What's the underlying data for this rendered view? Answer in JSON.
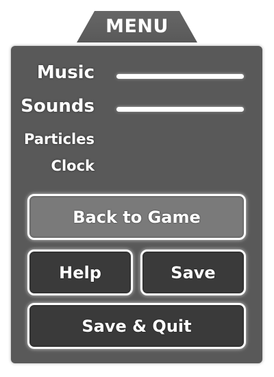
{
  "header": {
    "title": "MENU"
  },
  "settings": {
    "music": {
      "label": "Music",
      "level": 1.0
    },
    "sounds": {
      "label": "Sounds",
      "level": 1.0
    },
    "particles": {
      "label": "Particles"
    },
    "clock": {
      "label": "Clock"
    }
  },
  "buttons": {
    "back": "Back to Game",
    "help": "Help",
    "save": "Save",
    "save_quit": "Save & Quit"
  },
  "colors": {
    "panel": "#595959",
    "button_highlight": "#7a7a7a",
    "button_dark": "#3a3a3a",
    "text": "#ffffff"
  }
}
